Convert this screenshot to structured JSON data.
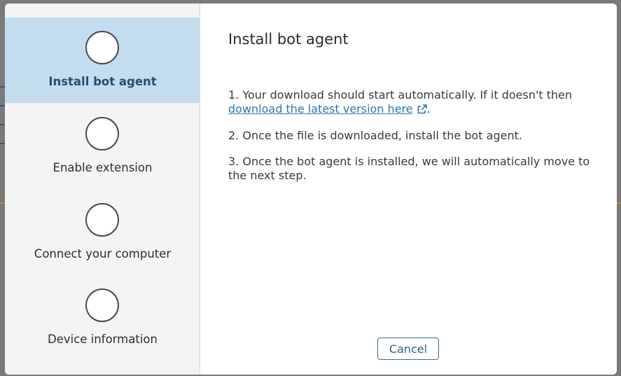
{
  "dialog": {
    "steps": [
      {
        "label": "Install bot agent",
        "active": true
      },
      {
        "label": "Enable extension",
        "active": false
      },
      {
        "label": "Connect your computer",
        "active": false
      },
      {
        "label": "Device information",
        "active": false
      }
    ],
    "title": "Install bot agent",
    "instructions": {
      "step1_text": "1. Your download should start automatically. If it doesn't then",
      "step1_link": "download the latest version here",
      "step1_suffix": ".",
      "step2": "2. Once the file is downloaded, install the bot agent.",
      "step3": "3. Once the bot agent is installed, we will automatically move to the next step."
    },
    "cancel_label": "Cancel"
  },
  "icons": {
    "link": "external-link-icon"
  },
  "colors": {
    "active_step_bg": "#c3ddef",
    "link": "#2d75b5",
    "button_border": "#3b6d93"
  }
}
